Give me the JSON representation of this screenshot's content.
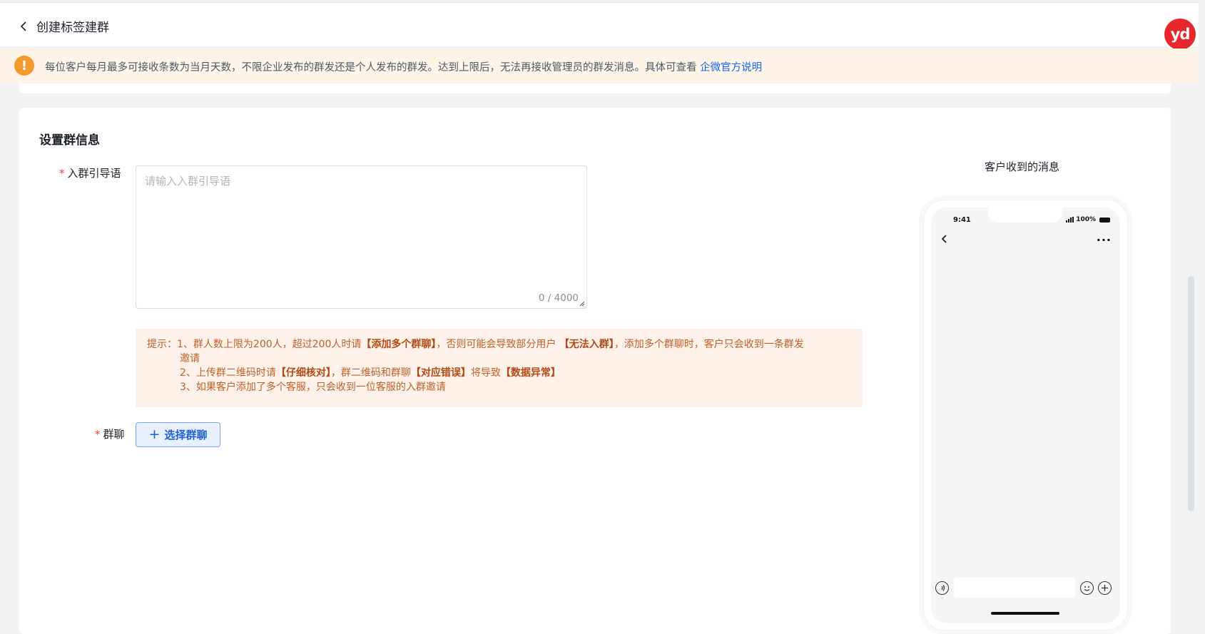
{
  "header": {
    "title": "创建标签建群",
    "badge": "yd"
  },
  "notice": {
    "icon": "!",
    "text": "每位客户每月最多可接收条数为当月天数，不限企业发布的群发还是个人发布的群发。达到上限后，无法再接收管理员的群发消息。具体可查看",
    "link": "企微官方说明"
  },
  "section": {
    "title": "设置群信息"
  },
  "form": {
    "required_mark": "*",
    "guide_label": "入群引导语",
    "guide_placeholder": "请输入入群引导语",
    "guide_count": "0 / 4000",
    "group_label": "群聊",
    "select_button": "选择群聊",
    "select_icon": "+"
  },
  "tips": {
    "line1_prefix": "提示：1、群人数上限为200人，超过200人时请",
    "line1_b1": "【添加多个群聊】",
    "line1_mid": "，否则可能会导致部分用户 ",
    "line1_b2": "【无法入群】",
    "line1_suffix": "，添加多个群聊时，客户只会收到一条群发",
    "line1_wrap": "邀请",
    "line2_prefix": "2、上传群二维码时请",
    "line2_b1": "【仔细核对】",
    "line2_mid": "，群二维码和群聊",
    "line2_b2": "【对应错误】",
    "line2_mid2": "将导致",
    "line2_b3": "【数据异常】",
    "line3": "3、如果客户添加了多个客服，只会收到一位客服的入群邀请"
  },
  "preview": {
    "title": "客户收到的消息",
    "time": "9:41",
    "battery": "100%",
    "more": "···"
  },
  "colors": {
    "accent": "#1664ff",
    "warning": "#f29a2e",
    "danger": "#f53f3f",
    "tip_text": "#c0602a",
    "badge": "#e8262d"
  }
}
